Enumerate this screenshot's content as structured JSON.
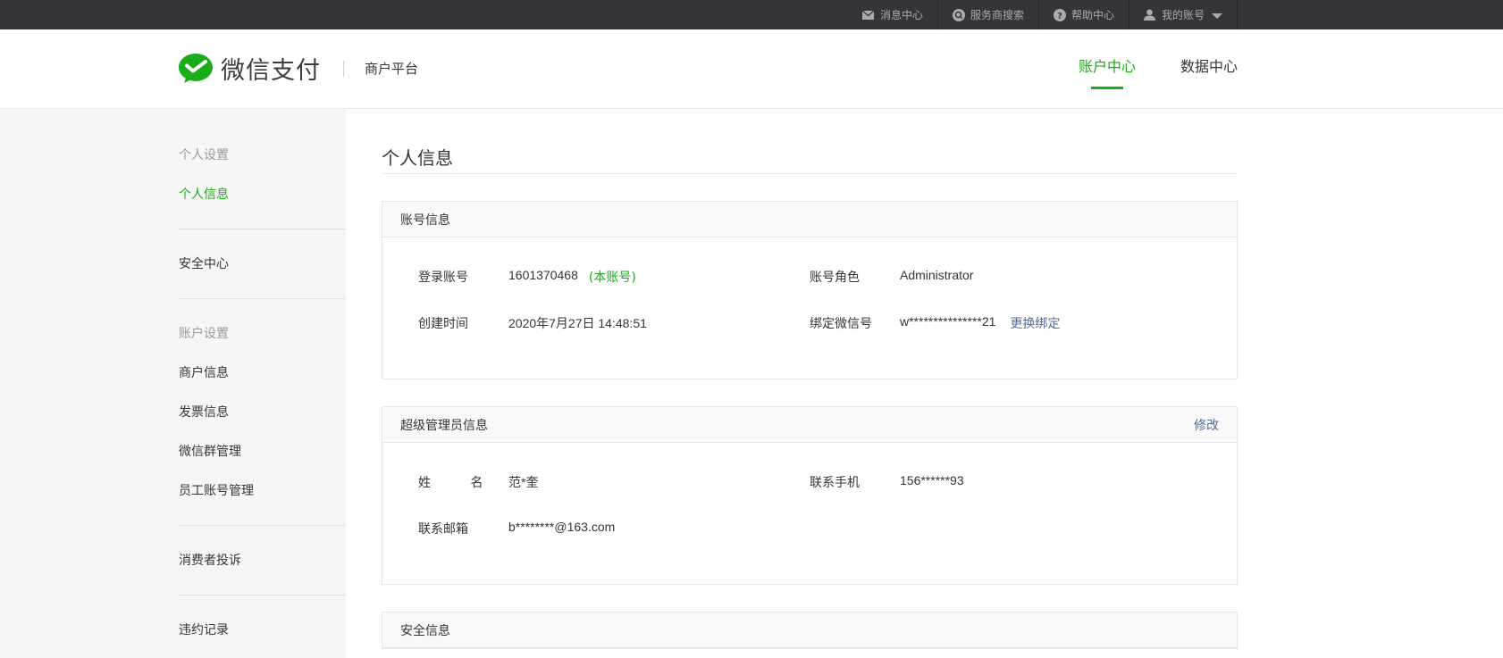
{
  "topbar": {
    "items": [
      {
        "label": "消息中心",
        "icon": "mail-icon"
      },
      {
        "label": "服务商搜索",
        "icon": "search-icon"
      },
      {
        "label": "帮助中心",
        "icon": "help-icon"
      },
      {
        "label": "我的账号",
        "icon": "user-icon"
      }
    ]
  },
  "header": {
    "brand": "微信支付",
    "subtitle": "商户平台",
    "nav": [
      {
        "label": "账户中心",
        "active": true
      },
      {
        "label": "数据中心",
        "active": false
      }
    ]
  },
  "sidebar": {
    "group1_title": "个人设置",
    "personal_info": "个人信息",
    "security_center": "安全中心",
    "group2_title": "账户设置",
    "merchant_info": "商户信息",
    "invoice_info": "发票信息",
    "wechat_group": "微信群管理",
    "staff_accounts": "员工账号管理",
    "consumer_complaints": "消费者投诉",
    "violation_records": "违约记录"
  },
  "main": {
    "title": "个人信息",
    "account_panel": {
      "title": "账号信息",
      "login_label": "登录账号",
      "login_value": "1601370468",
      "login_badge": "(本账号)",
      "role_label": "账号角色",
      "role_value": "Administrator",
      "created_label": "创建时间",
      "created_value": "2020年7月27日 14:48:51",
      "wechat_label": "绑定微信号",
      "wechat_value": "w***************21",
      "rebind_label": "更换绑定"
    },
    "admin_panel": {
      "title": "超级管理员信息",
      "edit_label": "修改",
      "name_label": "姓 名",
      "name_value": "范*奎",
      "phone_label": "联系手机",
      "phone_value": "156******93",
      "email_label": "联系邮箱",
      "email_value": "b********@163.com"
    },
    "security_panel": {
      "title": "安全信息"
    }
  },
  "colors": {
    "accent": "#1aad19",
    "link": "#576b95",
    "topbar": "#33353b"
  }
}
